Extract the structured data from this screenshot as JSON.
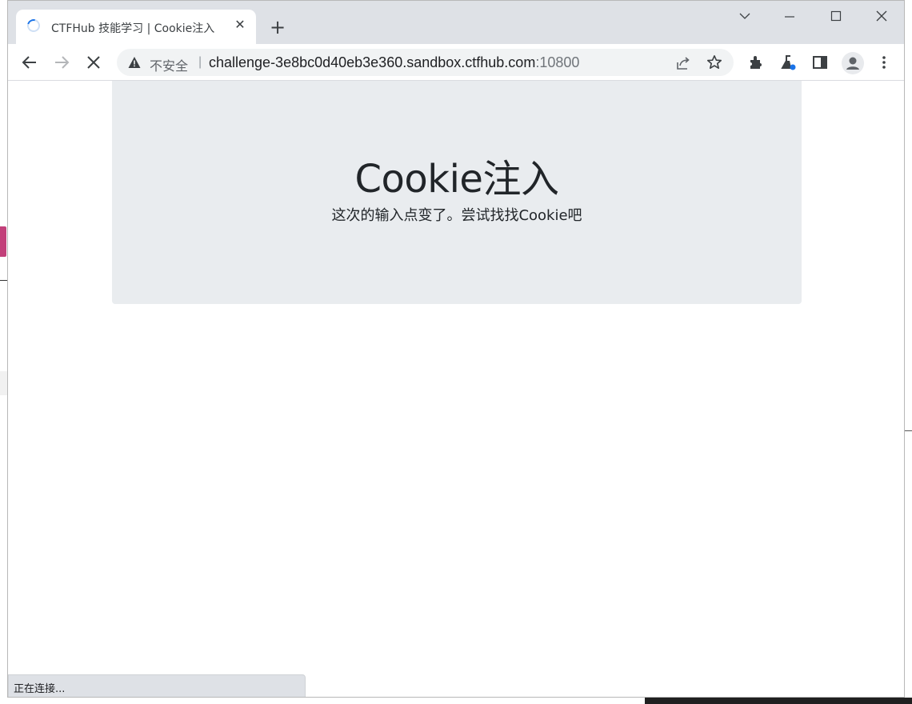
{
  "browser": {
    "tab": {
      "title": "CTFHub 技能学习 | Cookie注入",
      "close_glyph": "✕"
    },
    "new_tab_glyph": "+",
    "address_bar": {
      "security_label": "不安全",
      "separator": "|",
      "host": "challenge-3e8bc0d40eb3e360.sandbox.ctfhub.com",
      "port": ":10800"
    },
    "status_text": "正在连接...",
    "icons": [
      "loading-spinner-icon",
      "close-icon",
      "plus-icon",
      "chevron-down-icon",
      "minimize-icon",
      "maximize-icon",
      "close-window-icon",
      "back-icon",
      "forward-icon",
      "stop-icon",
      "warning-icon",
      "share-icon",
      "star-icon",
      "extensions-icon",
      "labs-icon",
      "side-panel-icon",
      "profile-icon",
      "more-icon"
    ]
  },
  "page": {
    "heading": "Cookie注入",
    "subtitle": "这次的输入点变了。尝试找找Cookie吧"
  },
  "colors": {
    "tabstrip": "#dee1e6",
    "jumbotron": "#e9ecef",
    "accent": "#1a73e8"
  }
}
